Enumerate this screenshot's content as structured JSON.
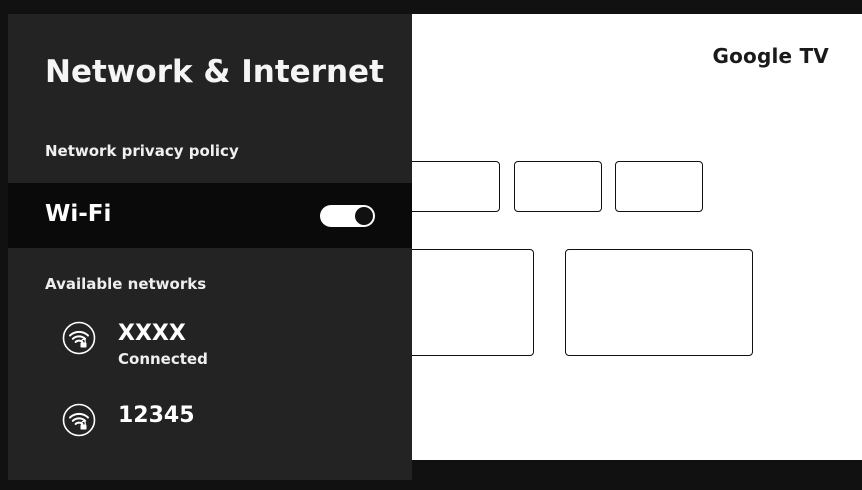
{
  "brand": "Google TV",
  "panel": {
    "title": "Network & Internet",
    "privacy_link": "Network privacy policy",
    "wifi": {
      "label": "Wi-Fi",
      "enabled": true
    },
    "available_label": "Available networks",
    "networks": [
      {
        "name": "XXXX",
        "status": "Connected",
        "icon": "wifi-lock-icon"
      },
      {
        "name": "12345",
        "status": "",
        "icon": "wifi-lock-icon"
      }
    ]
  },
  "colors": {
    "panel_bg": "#232323",
    "selected_row_bg": "#0a0a0a",
    "toggle_on": "#ffffff",
    "tv_bg": "#ffffff"
  }
}
